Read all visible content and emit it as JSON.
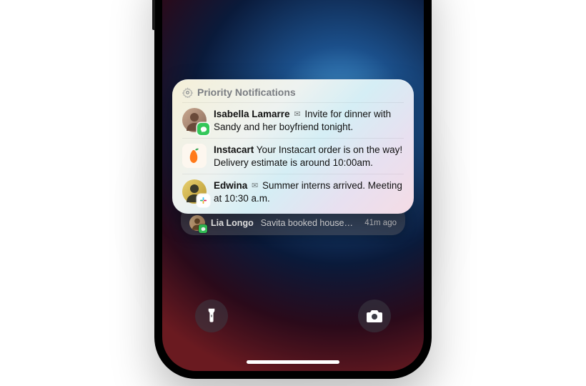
{
  "priority": {
    "header": "Priority Notifications",
    "items": [
      {
        "sender": "Isabella Lamarre",
        "message": "Invite for dinner with Sandy and her boyfriend tonight.",
        "show_reply_glyph": true,
        "avatar_bg": "#b89080",
        "badge_app": "messages",
        "badge_bg": "#34c759"
      },
      {
        "sender": "Instacart",
        "message": "Your Instacart order is on the way! Delivery estimate is around 10:00am.",
        "show_reply_glyph": false,
        "app_icon": "instacart",
        "app_icon_bg": "#fdf7ef"
      },
      {
        "sender": "Edwina",
        "message": "Summer interns arrived. Meeting at 10:30 a.m.",
        "show_reply_glyph": true,
        "avatar_bg": "#d6b84a",
        "badge_app": "slack",
        "badge_bg": "#ffffff"
      }
    ]
  },
  "secondary": {
    "sender": "Lia Longo",
    "message": "Savita booked house…",
    "time": "41m ago",
    "avatar_bg": "#c49a6c",
    "badge_app": "messages"
  },
  "icons": {
    "gear": "gear-icon",
    "flashlight": "flashlight-icon",
    "camera": "camera-icon"
  }
}
